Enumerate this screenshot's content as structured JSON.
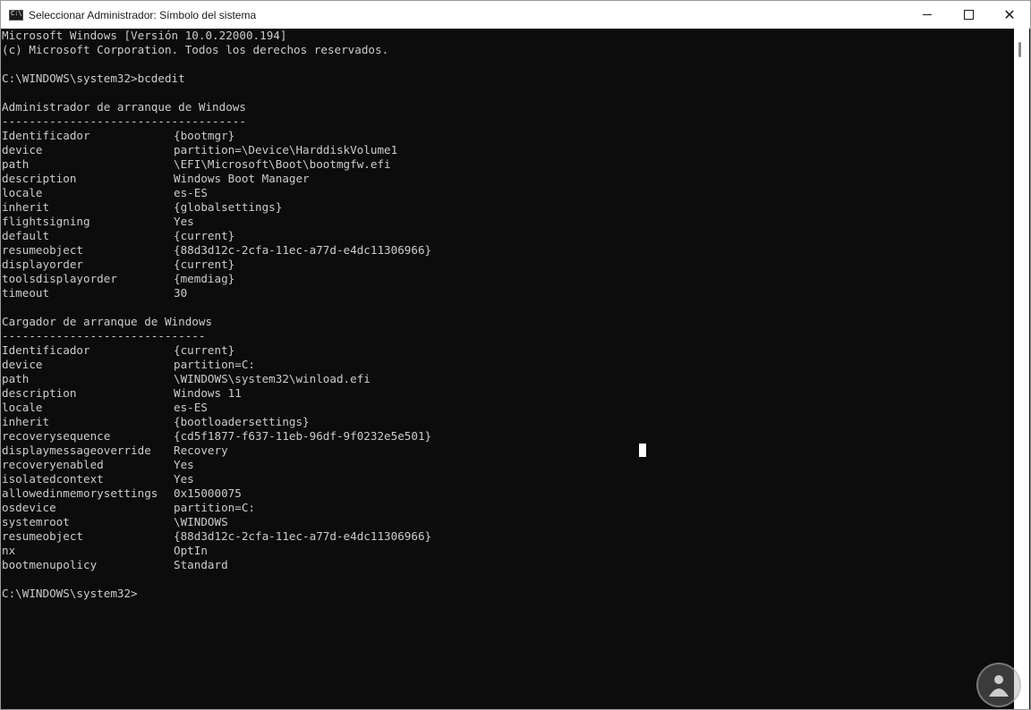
{
  "window": {
    "title": "Seleccionar Administrador: Símbolo del sistema",
    "controls": {
      "minimize": "",
      "maximize": "",
      "close": "✕"
    }
  },
  "console": {
    "header": [
      "Microsoft Windows [Versión 10.0.22000.194]",
      "(c) Microsoft Corporation. Todos los derechos reservados."
    ],
    "prompt_command": "C:\\WINDOWS\\system32>bcdedit",
    "sections": [
      {
        "title": "Administrador de arranque de Windows",
        "underline": "------------------------------------",
        "entries": [
          {
            "key": "Identificador",
            "value": "{bootmgr}"
          },
          {
            "key": "device",
            "value": "partition=\\Device\\HarddiskVolume1"
          },
          {
            "key": "path",
            "value": "\\EFI\\Microsoft\\Boot\\bootmgfw.efi"
          },
          {
            "key": "description",
            "value": "Windows Boot Manager"
          },
          {
            "key": "locale",
            "value": "es-ES"
          },
          {
            "key": "inherit",
            "value": "{globalsettings}"
          },
          {
            "key": "flightsigning",
            "value": "Yes"
          },
          {
            "key": "default",
            "value": "{current}"
          },
          {
            "key": "resumeobject",
            "value": "{88d3d12c-2cfa-11ec-a77d-e4dc11306966}"
          },
          {
            "key": "displayorder",
            "value": "{current}"
          },
          {
            "key": "toolsdisplayorder",
            "value": "{memdiag}"
          },
          {
            "key": "timeout",
            "value": "30"
          }
        ]
      },
      {
        "title": "Cargador de arranque de Windows",
        "underline": "------------------------------",
        "entries": [
          {
            "key": "Identificador",
            "value": "{current}"
          },
          {
            "key": "device",
            "value": "partition=C:"
          },
          {
            "key": "path",
            "value": "\\WINDOWS\\system32\\winload.efi"
          },
          {
            "key": "description",
            "value": "Windows 11"
          },
          {
            "key": "locale",
            "value": "es-ES"
          },
          {
            "key": "inherit",
            "value": "{bootloadersettings}"
          },
          {
            "key": "recoverysequence",
            "value": "{cd5f1877-f637-11eb-96df-9f0232e5e501}"
          },
          {
            "key": "displaymessageoverride",
            "value": "Recovery"
          },
          {
            "key": "recoveryenabled",
            "value": "Yes"
          },
          {
            "key": "isolatedcontext",
            "value": "Yes"
          },
          {
            "key": "allowedinmemorysettings",
            "value": "0x15000075"
          },
          {
            "key": "osdevice",
            "value": "partition=C:"
          },
          {
            "key": "systemroot",
            "value": "\\WINDOWS"
          },
          {
            "key": "resumeobject",
            "value": "{88d3d12c-2cfa-11ec-a77d-e4dc11306966}"
          },
          {
            "key": "nx",
            "value": "OptIn"
          },
          {
            "key": "bootmenupolicy",
            "value": "Standard"
          }
        ]
      }
    ],
    "final_prompt": "C:\\WINDOWS\\system32>"
  },
  "colors": {
    "console_background": "#0c0c0c",
    "console_text": "#cccccc",
    "titlebar_background": "#ffffff"
  },
  "icons": {
    "app": "cmd-app-icon",
    "watermark": "watermark-logo-icon"
  }
}
